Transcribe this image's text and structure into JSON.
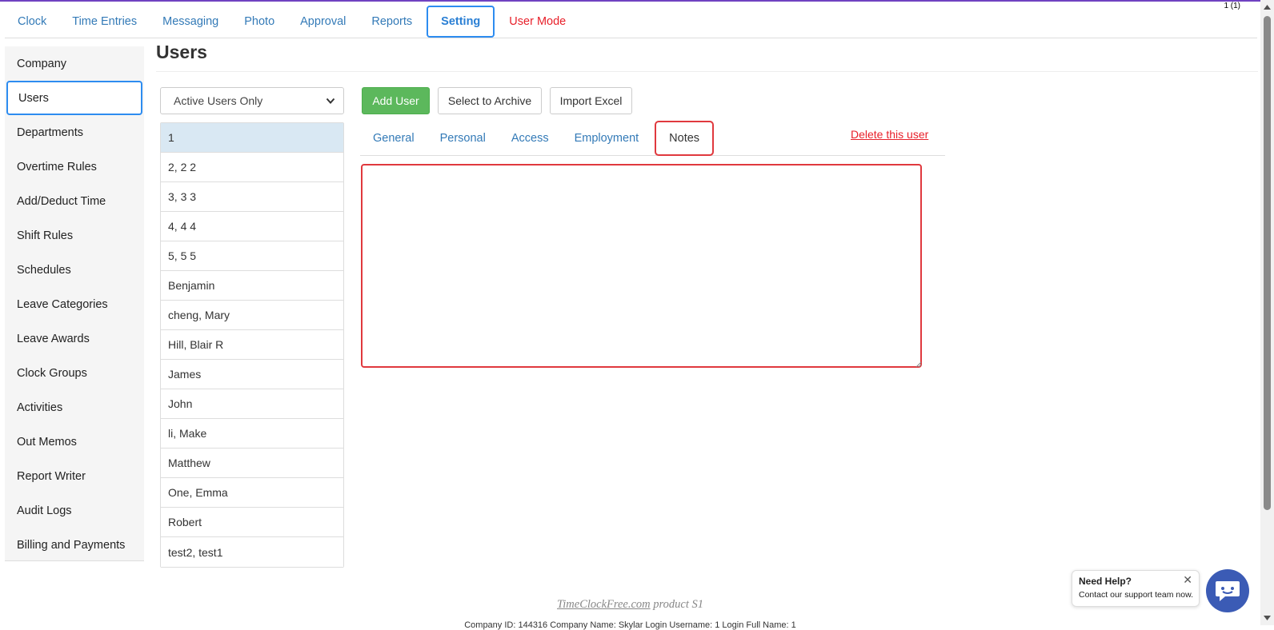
{
  "page_counter": "1 (1)",
  "top_nav": {
    "tabs": [
      {
        "label": "Clock"
      },
      {
        "label": "Time Entries"
      },
      {
        "label": "Messaging"
      },
      {
        "label": "Photo"
      },
      {
        "label": "Approval"
      },
      {
        "label": "Reports"
      },
      {
        "label": "Setting",
        "active": true
      },
      {
        "label": "User Mode"
      }
    ]
  },
  "sidebar": {
    "items": [
      {
        "label": "Company"
      },
      {
        "label": "Users",
        "active": true
      },
      {
        "label": "Departments"
      },
      {
        "label": "Overtime Rules"
      },
      {
        "label": "Add/Deduct Time"
      },
      {
        "label": "Shift Rules"
      },
      {
        "label": "Schedules"
      },
      {
        "label": "Leave Categories"
      },
      {
        "label": "Leave Awards"
      },
      {
        "label": "Clock Groups"
      },
      {
        "label": "Activities"
      },
      {
        "label": "Out Memos"
      },
      {
        "label": "Report Writer"
      },
      {
        "label": "Audit Logs"
      },
      {
        "label": "Billing and Payments"
      }
    ]
  },
  "main": {
    "title": "Users",
    "filter_selected": "Active Users Only",
    "buttons": {
      "add_user": "Add User",
      "select_to_archive": "Select to Archive",
      "import_excel": "Import Excel"
    },
    "users": [
      {
        "name": "1",
        "selected": true
      },
      {
        "name": "2, 2 2"
      },
      {
        "name": "3, 3 3"
      },
      {
        "name": "4, 4 4"
      },
      {
        "name": "5, 5 5"
      },
      {
        "name": "Benjamin"
      },
      {
        "name": "cheng, Mary"
      },
      {
        "name": "Hill, Blair R"
      },
      {
        "name": "James"
      },
      {
        "name": "John"
      },
      {
        "name": "li, Make"
      },
      {
        "name": "Matthew"
      },
      {
        "name": "One, Emma"
      },
      {
        "name": "Robert"
      },
      {
        "name": "test2, test1"
      }
    ],
    "detail_tabs": [
      {
        "label": "General"
      },
      {
        "label": "Personal"
      },
      {
        "label": "Access"
      },
      {
        "label": "Employment"
      },
      {
        "label": "Notes",
        "active": true
      }
    ],
    "delete_link": "Delete this user",
    "notes_value": ""
  },
  "footer": {
    "product_link": "TimeClockFree.com",
    "product_suffix": " product S1",
    "info_line": "Company ID: 144316   Company Name: Skylar   Login Username: 1   Login Full Name: 1"
  },
  "help": {
    "title": "Need Help?",
    "subtitle": "Contact our support team now.",
    "close_glyph": "✕"
  },
  "colors": {
    "link_blue": "#337ab7",
    "active_outline": "#2d8cf0",
    "highlight_red": "#e0393e",
    "add_button_green": "#5cb85c",
    "selected_row": "#d9e8f3",
    "chat_button": "#3b5bb5"
  },
  "icons": {
    "select_chevron": "chevron-down-icon",
    "chat": "chat-bubble-icon",
    "close": "close-icon",
    "resize_grip": "resize-grip-icon"
  }
}
